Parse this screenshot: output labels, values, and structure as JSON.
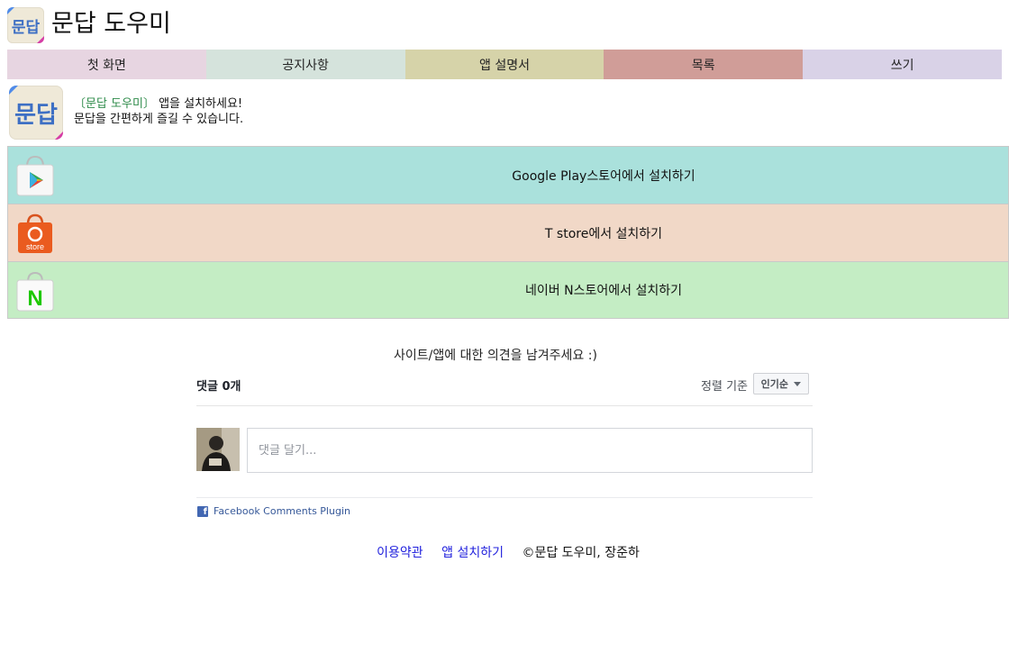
{
  "header": {
    "logo_text": "문답",
    "site_title": "문답 도우미"
  },
  "nav": {
    "items": [
      {
        "label": "첫 화면",
        "color": "#e7d5e1"
      },
      {
        "label": "공지사항",
        "color": "#d5e3dc"
      },
      {
        "label": "앱 설명서",
        "color": "#d6d3a9"
      },
      {
        "label": "목록",
        "color": "#d09d98"
      },
      {
        "label": "쓰기",
        "color": "#d9d2e7"
      }
    ]
  },
  "promo": {
    "logo_text": "문답",
    "app_name": "〔문답 도우미〕",
    "line1_suffix": " 앱을 설치하세요!",
    "line2": "문답을 간편하게 즐길 수 있습니다."
  },
  "stores": [
    {
      "label": "Google Play스토어에서 설치하기",
      "color": "#aae1dc",
      "icon": "google-play-icon"
    },
    {
      "label": "T store에서 설치하기",
      "color": "#f1d8c7",
      "icon": "t-store-icon"
    },
    {
      "label": "네이버 N스토어에서 설치하기",
      "color": "#c4edc4",
      "icon": "naver-n-store-icon"
    }
  ],
  "comments": {
    "prompt": "사이트/앱에 대한 의견을 남겨주세요 :)",
    "count_label": "댓글 0개",
    "sort_label": "정렬 기준",
    "sort_value": "인기순",
    "input_placeholder": "댓글 달기...",
    "plugin_label": "Facebook Comments Plugin",
    "fb_icon_letter": "f"
  },
  "footer": {
    "terms_link": "이용약관",
    "install_link": "앱 설치하기",
    "copyright": "©문답 도우미, 장준하"
  }
}
